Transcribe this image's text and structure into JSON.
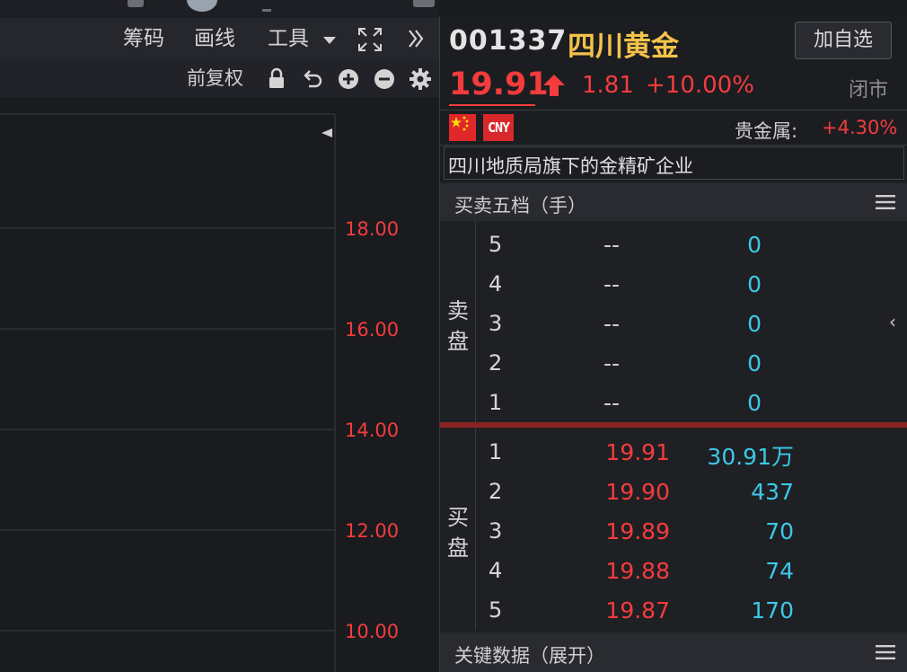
{
  "toolbar": {
    "items": [
      "筹码",
      "画线",
      "工具"
    ],
    "restore_label": "前复权"
  },
  "chart": {
    "yticks": [
      "18.00",
      "16.00",
      "14.00",
      "12.00",
      "10.00"
    ],
    "tick_color": "#f43c3c"
  },
  "stock": {
    "code": "001337",
    "name": "四川黄金",
    "add_label": "加自选",
    "price": "19.91",
    "change": "1.81",
    "change_pct": "+10.00%",
    "status": "闭市",
    "currency": "CNY",
    "sector_label": "贵金属:",
    "sector_change": "+4.30%",
    "description": "四川地质局旗下的金精矿企业"
  },
  "order_book": {
    "title": "买卖五档（手）",
    "sell_label": [
      "卖",
      "盘"
    ],
    "buy_label": [
      "买",
      "盘"
    ],
    "asks": [
      {
        "level": "5",
        "price": "--",
        "volume": "0"
      },
      {
        "level": "4",
        "price": "--",
        "volume": "0"
      },
      {
        "level": "3",
        "price": "--",
        "volume": "0"
      },
      {
        "level": "2",
        "price": "--",
        "volume": "0"
      },
      {
        "level": "1",
        "price": "--",
        "volume": "0"
      }
    ],
    "bids": [
      {
        "level": "1",
        "price": "19.91",
        "volume": "30.91万"
      },
      {
        "level": "2",
        "price": "19.90",
        "volume": "437"
      },
      {
        "level": "3",
        "price": "19.89",
        "volume": "70"
      },
      {
        "level": "4",
        "price": "19.88",
        "volume": "74"
      },
      {
        "level": "5",
        "price": "19.87",
        "volume": "170"
      }
    ]
  },
  "key_data": {
    "title": "关键数据（展开）"
  },
  "colors": {
    "up": "#f43c3c",
    "volume": "#3cc8e8",
    "name": "#f3c24b"
  }
}
